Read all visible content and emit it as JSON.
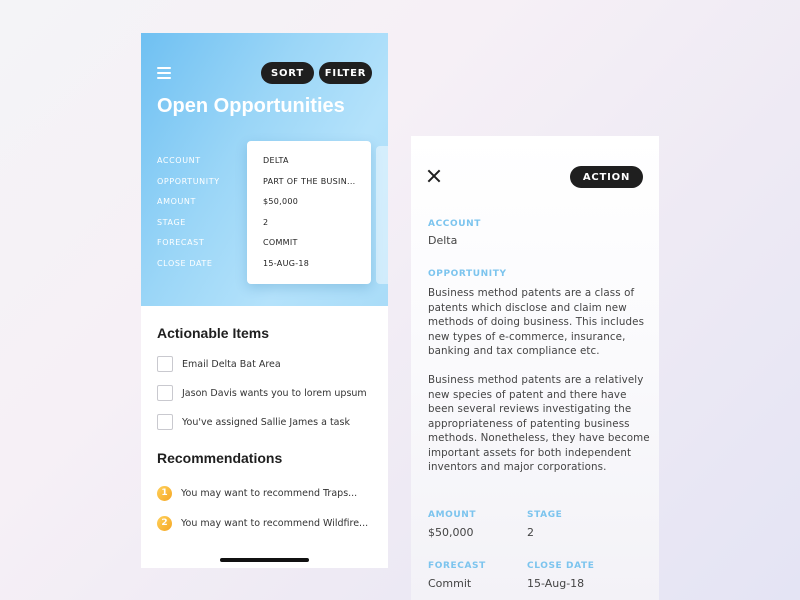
{
  "left": {
    "header": {
      "sort_label": "SORT",
      "filter_label": "FILTER",
      "title": "Open Opportunities"
    },
    "fields": [
      "ACCOUNT",
      "OPPORTUNITY",
      "AMOUNT",
      "STAGE",
      "FORECAST",
      "CLOSE DATE"
    ],
    "card": {
      "values": [
        "DELTA",
        "PART OF THE BUSIN...",
        "$50,000",
        "2",
        "COMMIT",
        "15-AUG-18"
      ]
    },
    "actionable": {
      "title": "Actionable Items",
      "items": [
        "Email Delta Bat Area",
        "Jason Davis wants you to lorem upsum",
        "You've assigned Sallie James a task"
      ]
    },
    "recommendations": {
      "title": "Recommendations",
      "items": [
        {
          "num": "1",
          "label": "You may want to recommend Traps..."
        },
        {
          "num": "2",
          "label": "You may want to recommend Wildfire..."
        }
      ]
    }
  },
  "right": {
    "action_label": "ACTION",
    "account_label": "ACCOUNT",
    "account_value": "Delta",
    "opportunity_label": "OPPORTUNITY",
    "opportunity_para1": "Business method patents are a class of patents which disclose and claim new methods of doing business. This includes new types of e-commerce, insurance, banking and tax compliance etc.",
    "opportunity_para2": "Business method patents are a relatively new species of patent and there have been several reviews investigating the appropriateness of patenting business methods. Nonetheless, they have become important assets for both independent inventors and major corporations.",
    "amount_label": "AMOUNT",
    "amount_value": "$50,000",
    "stage_label": "STAGE",
    "stage_value": "2",
    "forecast_label": "FORECAST",
    "forecast_value": "Commit",
    "close_date_label": "CLOSE DATE",
    "close_date_value": "15-Aug-18"
  },
  "colors": {
    "accent_blue": "#7cc4ee",
    "hero_gradient_start": "#6fc0f2",
    "badge_orange": "#f5a623",
    "dark_pill": "#1f1f1f"
  }
}
